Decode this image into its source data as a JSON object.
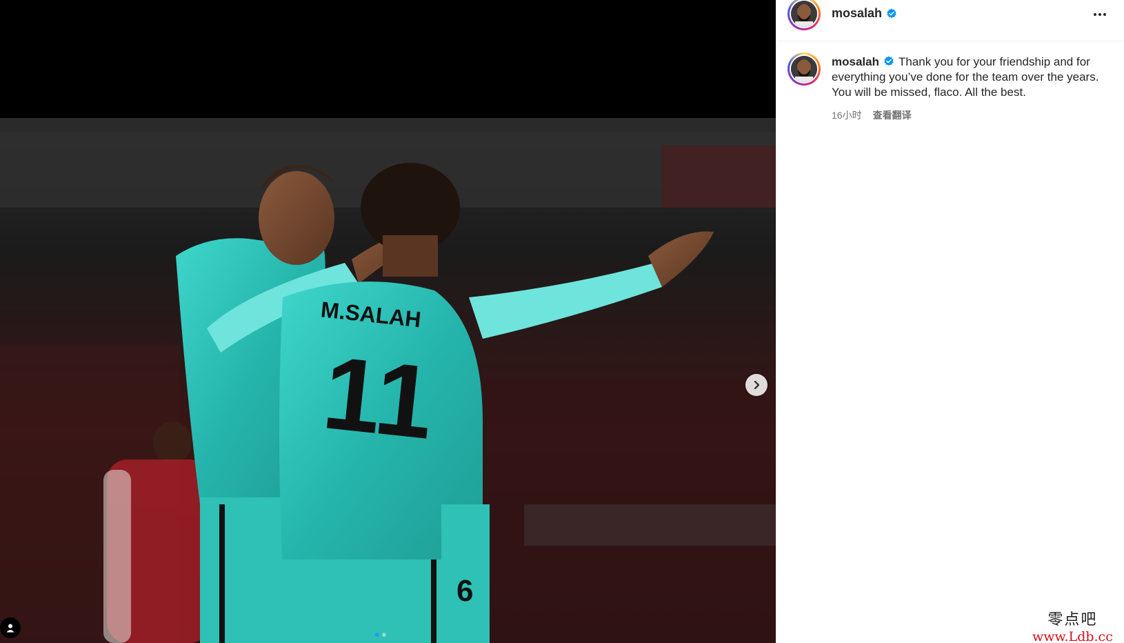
{
  "post": {
    "username": "mosalah",
    "caption": "Thank you for your friendship and for everything you’ve done for the team over the years. You will be missed, flaco. All the best.",
    "time": "16小时",
    "translate_label": "查看翻译"
  },
  "photo": {
    "jersey_name": "M.SALAH",
    "jersey_number": "11",
    "back_number": "6",
    "carousel_count": 2,
    "carousel_active": 1
  },
  "icons": {
    "verified": "verified-badge-icon",
    "more": "more-options-icon",
    "next": "chevron-right-icon",
    "tags": "user-tag-icon"
  },
  "colors": {
    "verified": "#0095f6",
    "jersey": "#35c7bd"
  },
  "watermark": {
    "cn": "零点吧",
    "url": "www.Ldb.cc"
  }
}
